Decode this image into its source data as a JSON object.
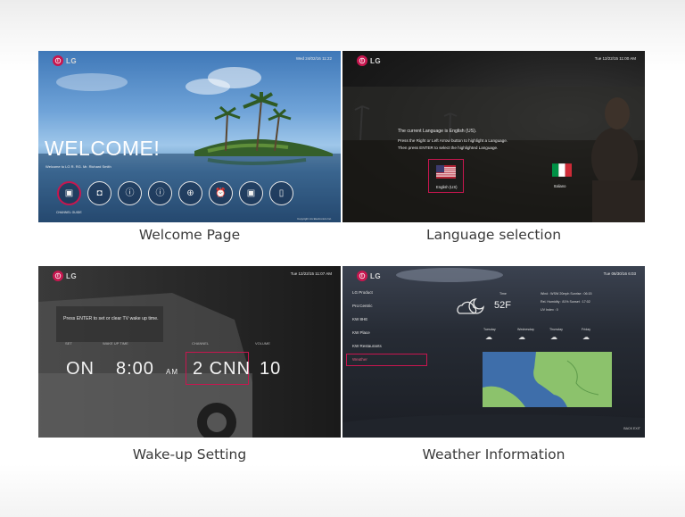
{
  "captions": {
    "welcome": "Welcome Page",
    "language": "Language selection",
    "wakeup": "Wake-up Setting",
    "weather": "Weather Information"
  },
  "brand": {
    "logo_text": "LG"
  },
  "welcome_panel": {
    "clock": "Wed 24/02/16 11:22",
    "title": "WELCOME!",
    "subtitle": "Welcome to LG R. RG. Mr. Richard Smith",
    "active_label": "CHANNEL GUIDE",
    "footer": "Copyright LG Electronics Inc.",
    "icons": [
      "tv-icon",
      "bag-icon",
      "info-icon",
      "info-icon",
      "globe-icon",
      "alarm-clock-icon",
      "tv-star-icon",
      "door-icon"
    ]
  },
  "language_panel": {
    "clock": "Tue 12/22/15 11:00 AM",
    "line1": "The current Language is English (US).",
    "line2": "Press the Right or Left Arrow button to highlight a Language.",
    "line3": "Then press ENTER to select the highlighted Language.",
    "option1": "English (US)",
    "option2": "Italiano"
  },
  "wakeup_panel": {
    "clock": "Tue 12/22/15 11:07 AM",
    "message": "Press ENTER to set or clear TV wake up time.",
    "labels": {
      "set": "SET",
      "time": "WAKE UP TIME",
      "channel": "CHANNEL",
      "volume": "VOLUME"
    },
    "values": {
      "set": "ON",
      "time": "8:00",
      "ampm": "AM",
      "channel": "2 CNN",
      "volume": "10"
    }
  },
  "weather_panel": {
    "clock": "Tue 06/30/16 6:03",
    "menu": [
      "LG Product",
      "Pro:Centric",
      "KW 8HE",
      "KW Place",
      "KW Restaurants",
      "Weather"
    ],
    "temp": "52F",
    "time_label": "Time",
    "wind": "Wind : WSW 20mph   Sunrise : 06:15",
    "humidity": "Rel. Humidity : 81%   Sunset : 17:02",
    "uv": "UV Index : 0",
    "forecast_days": [
      "Tuesday",
      "Wednesday",
      "Thursday",
      "Friday"
    ],
    "exit_hint": "BACK EXIT"
  },
  "colors": {
    "accent": "#c8164f",
    "caption_text": "#3a3a3a"
  }
}
